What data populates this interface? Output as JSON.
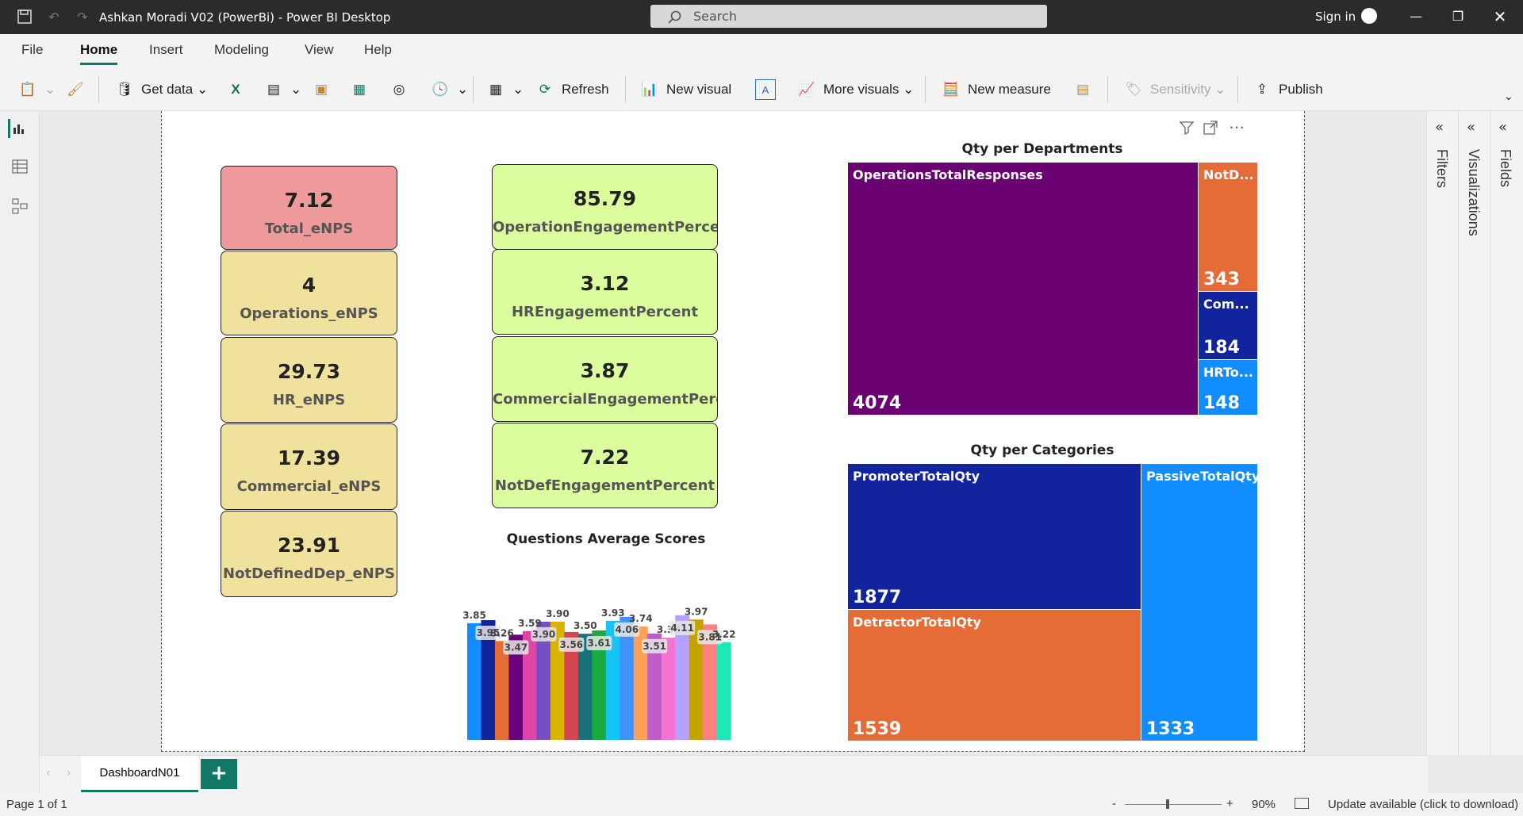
{
  "window": {
    "title": "Ashkan Moradi V02 (PowerBi) - Power BI Desktop",
    "search_placeholder": "Search",
    "signin": "Sign in"
  },
  "menu": [
    "File",
    "Home",
    "Insert",
    "Modeling",
    "View",
    "Help"
  ],
  "ribbon": {
    "get_data": "Get data",
    "refresh": "Refresh",
    "new_visual": "New visual",
    "more_visuals": "More visuals",
    "new_measure": "New measure",
    "sensitivity": "Sensitivity",
    "publish": "Publish"
  },
  "cards_enps": [
    {
      "value": "7.12",
      "label": "Total_eNPS"
    },
    {
      "value": "4",
      "label": "Operations_eNPS"
    },
    {
      "value": "29.73",
      "label": "HR_eNPS"
    },
    {
      "value": "17.39",
      "label": "Commercial_eNPS"
    },
    {
      "value": "23.91",
      "label": "NotDefinedDep_eNPS"
    }
  ],
  "cards_engagement": [
    {
      "value": "85.79",
      "label": "OperationEngagementPercent"
    },
    {
      "value": "3.12",
      "label": "HREngagementPercent"
    },
    {
      "value": "3.87",
      "label": "CommercialEngagementPerc..."
    },
    {
      "value": "7.22",
      "label": "NotDefEngagementPercent"
    }
  ],
  "treemap_departments": {
    "title": "Qty per Departments",
    "items": [
      {
        "name": "OperationsTotalResponses",
        "value": "4074",
        "color": "#6b0073"
      },
      {
        "name": "NotD...",
        "value": "343",
        "color": "#e66c37"
      },
      {
        "name": "Com...",
        "value": "184",
        "color": "#12239e"
      },
      {
        "name": "HRTo...",
        "value": "148",
        "color": "#118dff"
      }
    ]
  },
  "treemap_categories": {
    "title": "Qty per Categories",
    "items": [
      {
        "name": "PromoterTotalQty",
        "value": "1877",
        "color": "#12239e"
      },
      {
        "name": "DetractorTotalQty",
        "value": "1539",
        "color": "#e66c37"
      },
      {
        "name": "PassiveTotalQty",
        "value": "1333",
        "color": "#118dff"
      }
    ]
  },
  "chart_data": {
    "type": "bar",
    "title": "Questions Average Scores",
    "values": [
      3.85,
      3.95,
      3.26,
      3.47,
      3.59,
      3.9,
      3.9,
      3.56,
      3.5,
      3.61,
      3.93,
      4.06,
      3.74,
      3.51,
      3.37,
      4.11,
      3.97,
      3.81,
      3.22
    ],
    "labels": [
      "3.85",
      "3.95",
      "3.26",
      "3.47",
      "3.59",
      "3.90",
      "3.90",
      "3.56",
      "3.50",
      "3.61",
      "3.93",
      "4.06",
      "3.74",
      "3.51",
      "3.37",
      "4.11",
      "3.97",
      "3.81",
      "3.22"
    ],
    "colors": [
      "#118dff",
      "#12239e",
      "#e66c37",
      "#6b007b",
      "#e044a7",
      "#744ec2",
      "#d9b300",
      "#d64550",
      "#197278",
      "#1aab40",
      "#15c6f4",
      "#4092ff",
      "#ffa058",
      "#be5dc9",
      "#f472d0",
      "#b5a1ff",
      "#c4a200",
      "#ff8080",
      "#1de9b6"
    ],
    "ylim": [
      0,
      4.5
    ]
  },
  "tabs": {
    "page": "DashboardN01",
    "add": "+"
  },
  "status": {
    "page": "Page 1 of 1",
    "zoom": "90%",
    "update": "Update available (click to download)"
  },
  "panes": {
    "filters": "Filters",
    "visualizations": "Visualizations",
    "fields": "Fields"
  }
}
